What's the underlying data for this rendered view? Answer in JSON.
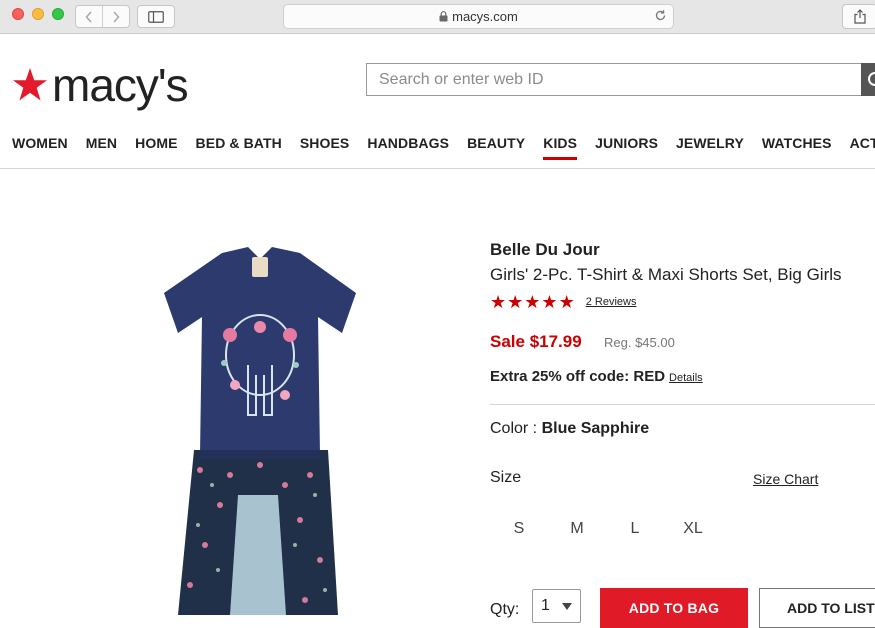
{
  "browser": {
    "url": "macys.com"
  },
  "header": {
    "logo_text": "macy's",
    "search_placeholder": "Search or enter web ID"
  },
  "nav": {
    "items": [
      "WOMEN",
      "MEN",
      "HOME",
      "BED & BATH",
      "SHOES",
      "HANDBAGS",
      "BEAUTY",
      "KIDS",
      "JUNIORS",
      "JEWELRY",
      "WATCHES",
      "ACTI"
    ],
    "active": "KIDS"
  },
  "product": {
    "brand": "Belle Du Jour",
    "title": "Girls' 2-Pc. T-Shirt & Maxi Shorts Set, Big Girls",
    "rating": 5,
    "reviews": "2 Reviews",
    "sale_price": "Sale $17.99",
    "reg_price": "Reg. $45.00",
    "promo": "Extra 25% off code: RED",
    "promo_link": "Details",
    "color_label": "Color : ",
    "color_value": "Blue Sapphire",
    "size_label": "Size",
    "size_chart": "Size Chart",
    "sizes": [
      "S",
      "M",
      "L",
      "XL"
    ],
    "qty_label": "Qty:",
    "qty_value": "1",
    "add_to_bag": "ADD TO BAG",
    "add_to_list": "ADD TO LIST"
  },
  "colors": {
    "brand_red": "#e11a27",
    "sale_red": "#cc0000",
    "shirt_navy": "#2c3a6e"
  }
}
